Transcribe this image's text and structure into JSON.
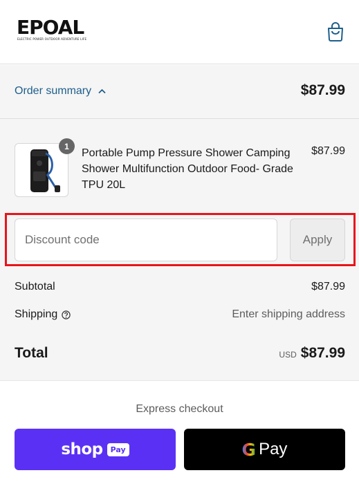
{
  "header": {
    "logo_text": "EPOAL",
    "logo_tagline": "ELECTRIC POWER OUTDOOR ADVENTURE LIFE",
    "cart_icon": "shopping-bag-icon"
  },
  "order_summary": {
    "toggle_label": "Order summary",
    "toggle_icon": "chevron-up-icon",
    "total": "$87.99",
    "link_color": "#1d5e8a"
  },
  "product": {
    "quantity": "1",
    "name": "Portable Pump Pressure Shower Camping Shower Multifunction Outdoor Food- Grade TPU 20L",
    "price": "$87.99"
  },
  "discount": {
    "placeholder": "Discount code",
    "value": "",
    "apply_label": "Apply",
    "highlight_color": "#e8141a"
  },
  "costs": {
    "subtotal_label": "Subtotal",
    "subtotal_value": "$87.99",
    "shipping_label": "Shipping",
    "shipping_info_icon": "help-circle-icon",
    "shipping_value": "Enter shipping address",
    "total_label": "Total",
    "currency": "USD",
    "total_value": "$87.99"
  },
  "express": {
    "title": "Express checkout",
    "shop_pay_word": "shop",
    "shop_pay_badge": "Pay",
    "shop_pay_color": "#5a31f4",
    "google_pay_g": "G",
    "google_pay_word": "Pay"
  }
}
